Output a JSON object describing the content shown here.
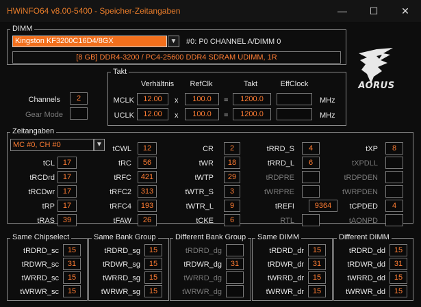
{
  "window": {
    "title": "HWiNFO64 v8.00-5400 - Speicher-Zeitangaben",
    "minimize_glyph": "—",
    "maximize_glyph": "☐",
    "close_glyph": "✕"
  },
  "dimm": {
    "group_label": "DIMM",
    "selected_module": "Kingston KF3200C16D4/8GX",
    "dropdown_glyph": "▼",
    "slot_info": "#0: P0 CHANNEL A/DIMM 0",
    "module_desc": "[8 GB] DDR4-3200 / PC4-25600 DDR4 SDRAM UDIMM, 1R"
  },
  "takt": {
    "group_label": "Takt",
    "headers": {
      "ratio": "Verhältnis",
      "refclk": "RefClk",
      "takt": "Takt",
      "effclock": "EffClock"
    },
    "mclk": {
      "label": "MCLK",
      "ratio": "12.00",
      "mult": "x",
      "refclk": "100.0",
      "eq": "=",
      "takt": "1200.0",
      "effclock": "",
      "unit": "MHz"
    },
    "uclk": {
      "label": "UCLK",
      "ratio": "12.00",
      "mult": "x",
      "refclk": "100.0",
      "eq": "=",
      "takt": "1200.0",
      "effclock": "",
      "unit": "MHz"
    }
  },
  "channels": {
    "label": "Channels",
    "value": "2"
  },
  "gear_mode": {
    "label": "Gear Mode",
    "value": ""
  },
  "brand": {
    "logo_text": "AORUS",
    "icon": "aorus-eagle-icon"
  },
  "zeit": {
    "group_label": "Zeitangaben",
    "selector": "MC #0, CH #0",
    "dropdown_glyph": "▼",
    "col1": [
      {
        "label": "tCL",
        "value": "17"
      },
      {
        "label": "tRCDrd",
        "value": "17"
      },
      {
        "label": "tRCDwr",
        "value": "17"
      },
      {
        "label": "tRP",
        "value": "17"
      },
      {
        "label": "tRAS",
        "value": "39"
      }
    ],
    "col2": [
      {
        "label": "tCWL",
        "value": "12"
      },
      {
        "label": "tRC",
        "value": "56"
      },
      {
        "label": "tRFC",
        "value": "421"
      },
      {
        "label": "tRFC2",
        "value": "313"
      },
      {
        "label": "tRFC4",
        "value": "193"
      },
      {
        "label": "tFAW",
        "value": "26"
      }
    ],
    "col3": [
      {
        "label": "CR",
        "value": "2"
      },
      {
        "label": "tWR",
        "value": "18"
      },
      {
        "label": "tWTP",
        "value": "29"
      },
      {
        "label": "tWTR_S",
        "value": "3"
      },
      {
        "label": "tWTR_L",
        "value": "9"
      },
      {
        "label": "tCKE",
        "value": "6"
      }
    ],
    "col4": [
      {
        "label": "tRRD_S",
        "value": "4"
      },
      {
        "label": "tRRD_L",
        "value": "6"
      },
      {
        "label": "tRDPRE",
        "value": ""
      },
      {
        "label": "tWRPRE",
        "value": ""
      },
      {
        "label": "tREFI",
        "value": "9364"
      },
      {
        "label": "RTL",
        "value": ""
      }
    ],
    "col5": [
      {
        "label": "tXP",
        "value": "8"
      },
      {
        "label": "tXPDLL",
        "value": ""
      },
      {
        "label": "tRDPDEN",
        "value": ""
      },
      {
        "label": "tWRPDEN",
        "value": ""
      },
      {
        "label": "tCPDED",
        "value": "4"
      },
      {
        "label": "tAONPD",
        "value": ""
      }
    ]
  },
  "groups": [
    {
      "title": "Same Chipselect",
      "rows": [
        {
          "label": "tRDRD_sc",
          "value": "15"
        },
        {
          "label": "tRDWR_sc",
          "value": "31"
        },
        {
          "label": "tWRRD_sc",
          "value": "15"
        },
        {
          "label": "tWRWR_sc",
          "value": "15"
        }
      ]
    },
    {
      "title": "Same Bank Group",
      "rows": [
        {
          "label": "tRDRD_sg",
          "value": "15"
        },
        {
          "label": "tRDWR_sg",
          "value": "15"
        },
        {
          "label": "tWRRD_sg",
          "value": "15"
        },
        {
          "label": "tWRWR_sg",
          "value": "15"
        }
      ]
    },
    {
      "title": "Different Bank Group",
      "rows": [
        {
          "label": "tRDRD_dg",
          "value": ""
        },
        {
          "label": "tRDWR_dg",
          "value": "31"
        },
        {
          "label": "tWRRD_dg",
          "value": ""
        },
        {
          "label": "tWRWR_dg",
          "value": ""
        }
      ]
    },
    {
      "title": "Same DIMM",
      "rows": [
        {
          "label": "tRDRD_dr",
          "value": "15"
        },
        {
          "label": "tRDWR_dr",
          "value": "31"
        },
        {
          "label": "tWRRD_dr",
          "value": "15"
        },
        {
          "label": "tWRWR_dr",
          "value": "15"
        }
      ]
    },
    {
      "title": "Different DIMM",
      "rows": [
        {
          "label": "tRDRD_dd",
          "value": "15"
        },
        {
          "label": "tRDWR_dd",
          "value": "31"
        },
        {
          "label": "tWRRD_dd",
          "value": "15"
        },
        {
          "label": "tWRWR_dd",
          "value": "15"
        }
      ]
    }
  ],
  "colors": {
    "accent": "#ff7d33",
    "background": "#0d0d0d",
    "combo_bg": "#f26f1c"
  }
}
